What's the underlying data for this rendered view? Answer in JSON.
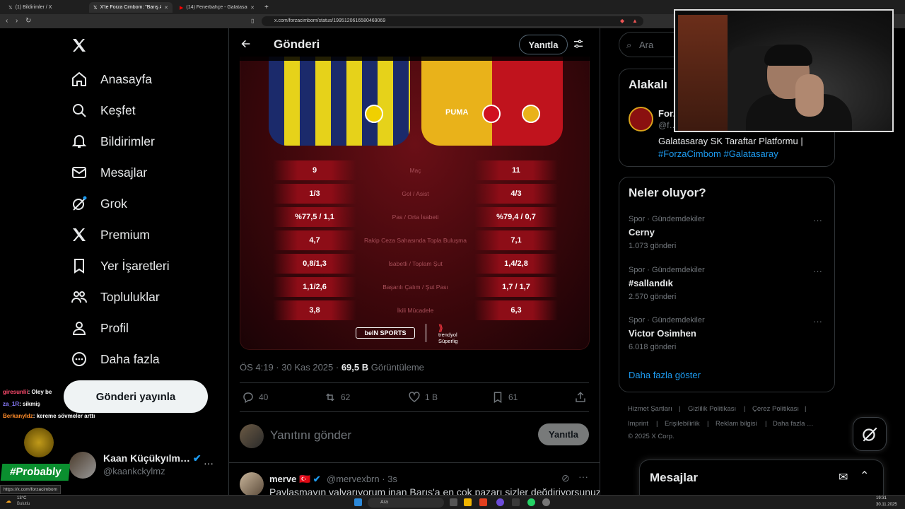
{
  "browser": {
    "tabs": [
      {
        "label": "(1) Bildirimler / X"
      },
      {
        "label": "X'te Forza Cimbom: \"Barış Alper…"
      },
      {
        "label": "(14) Fenerbahçe - Galatasaray Derbi…"
      }
    ],
    "url": "x.com/forzacimbom/status/1995120616580469069",
    "status_url": "https://x.com/forzacimbom"
  },
  "sidebar": {
    "items": [
      {
        "label": "Anasayfa",
        "icon": "home-icon"
      },
      {
        "label": "Keşfet",
        "icon": "search-icon"
      },
      {
        "label": "Bildirimler",
        "icon": "bell-icon"
      },
      {
        "label": "Mesajlar",
        "icon": "envelope-icon"
      },
      {
        "label": "Grok",
        "icon": "grok-icon"
      },
      {
        "label": "Premium",
        "icon": "x-icon"
      },
      {
        "label": "Yer İşaretleri",
        "icon": "bookmark-icon"
      },
      {
        "label": "Topluluklar",
        "icon": "people-icon"
      },
      {
        "label": "Profil",
        "icon": "person-icon"
      },
      {
        "label": "Daha fazla",
        "icon": "more-circle-icon"
      }
    ],
    "post_button": "Gönderi yayınla",
    "profile": {
      "name": "Kaan Küçükyılm…",
      "handle": "@kaankckylmz"
    }
  },
  "chat_overlay": [
    {
      "user": "giresunlii",
      "message": ": Oley be",
      "color": "#ff4b6e"
    },
    {
      "user": "za_1R",
      "message": ": sikmiş",
      "color": "#8a7dff"
    },
    {
      "user": "Berkanyldz",
      "message": ": kereme sövmeler arttı",
      "color": "#ff8c2a"
    }
  ],
  "stream_badge": "#Probably",
  "post": {
    "header_title": "Gönderi",
    "reply_top": "Yanıtla",
    "stats": [
      {
        "left": "9",
        "label": "Maç",
        "right": "11"
      },
      {
        "left": "1/3",
        "label": "Gol / Asist",
        "right": "4/3"
      },
      {
        "left": "%77,5 / 1,1",
        "label": "Pas / Orta İsabeti",
        "right": "%79,4 / 0,7"
      },
      {
        "left": "4,7",
        "label": "Rakip Ceza Sahasında Topla Buluşma",
        "right": "7,1"
      },
      {
        "left": "0,8/1,3",
        "label": "İsabetli / Toplam Şut",
        "right": "1,4/2,8"
      },
      {
        "left": "1,1/2,6",
        "label": "Başarılı Çalım / Şut Pası",
        "right": "1,7 / 1,7"
      },
      {
        "left": "3,8",
        "label": "İkili Mücadele",
        "right": "6,3"
      }
    ],
    "sponsor1": "beIN SPORTS",
    "sponsor2_line1": "trendyol",
    "sponsor2_line2": "Süperlig",
    "time": "ÖS 4:19 · 30 Kas 2025 · ",
    "views": "69,5 B",
    "views_label": " Görüntüleme",
    "actions": {
      "replies": "40",
      "reposts": "62",
      "likes": "1 B",
      "bookmarks": "61"
    },
    "reply_placeholder": "Yanıtını gönder",
    "reply_button": "Yanıtla"
  },
  "reply_tweet": {
    "name": "merve",
    "flag": "🇹🇷",
    "handle": "@mervexbrn · 3s",
    "text": "Paylaşmayın yalvarıyorum inan Barış'a en çok pazarı sizler değdiriyorsunuz"
  },
  "right": {
    "search_placeholder": "Ara",
    "related_title": "Alakalı",
    "related_name": "Forza Cimbom",
    "related_handle": "@f…",
    "related_bio": "Galatasaray SK Taraftar Platformu |",
    "related_tags": "#ForzaCimbom #Galatasaray",
    "trends_title": "Neler oluyor?",
    "trends": [
      {
        "category": "Spor · Gündemdekiler",
        "name": "Cerny",
        "posts": "1.073 gönderi"
      },
      {
        "category": "Spor · Gündemdekiler",
        "name": "#sallandık",
        "posts": "2.570 gönderi"
      },
      {
        "category": "Spor · Gündemdekiler",
        "name": "Victor Osimhen",
        "posts": "6.018 gönderi"
      }
    ],
    "show_more": "Daha fazla göster",
    "footer": [
      "Hizmet Şartları",
      "Gizlilik Politikası",
      "Çerez Politikası",
      "Imprint",
      "Erişilebilirlik",
      "Reklam bilgisi",
      "Daha fazla …",
      "© 2025 X Corp."
    ],
    "messages_title": "Mesajlar"
  },
  "taskbar": {
    "search": "Ara",
    "weather_temp": "13°C",
    "weather_label": "Bulutlu",
    "time": "19:31",
    "date": "30.11.2025"
  },
  "colors": {
    "accent": "#1d9bf0",
    "background": "#000000",
    "border": "#2f3336",
    "muted": "#71767b"
  }
}
